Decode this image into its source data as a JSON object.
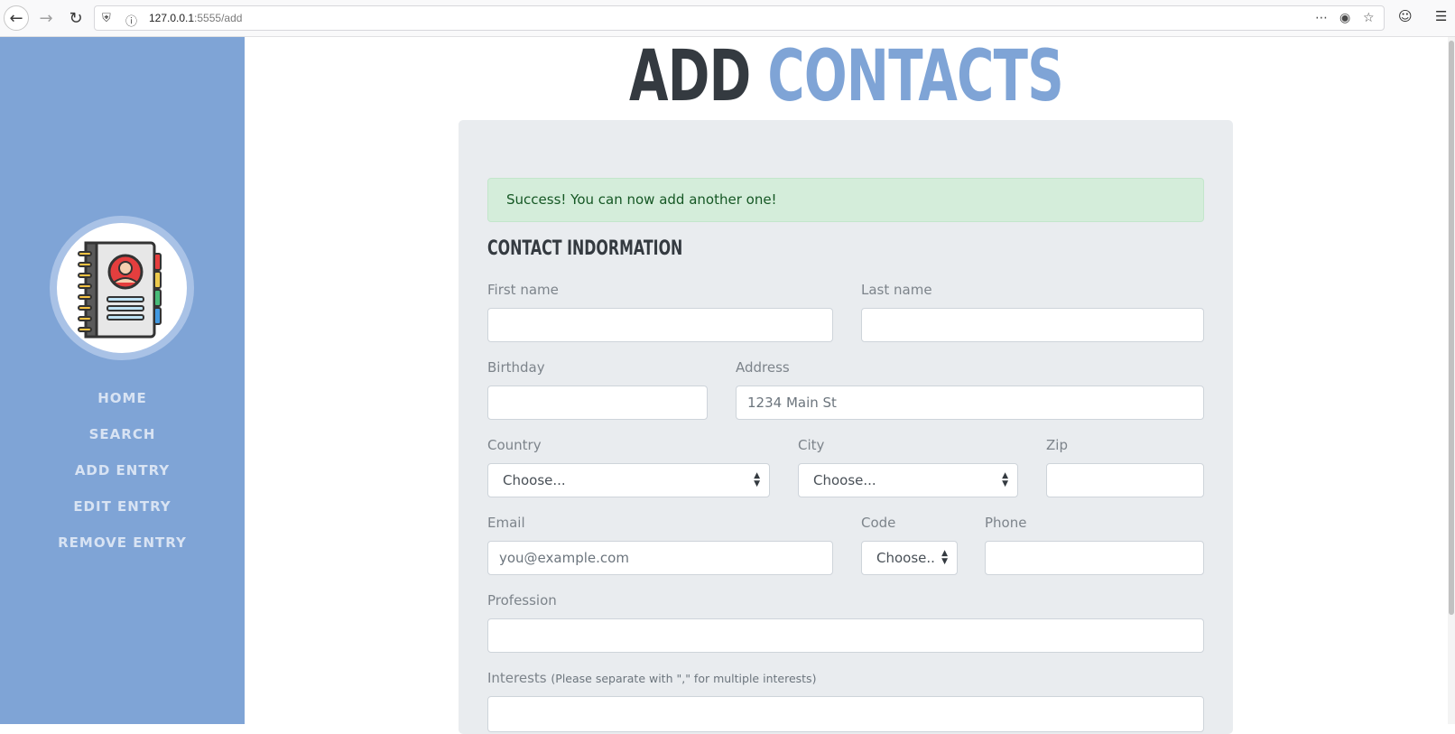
{
  "browser": {
    "url_host": "127.0.0.1",
    "url_path": ":5555/add"
  },
  "sidebar": {
    "items": [
      {
        "label": "HOME"
      },
      {
        "label": "SEARCH"
      },
      {
        "label": "ADD ENTRY"
      },
      {
        "label": "EDIT ENTRY"
      },
      {
        "label": "REMOVE ENTRY"
      }
    ]
  },
  "page": {
    "title_part1": "ADD",
    "title_part2": "CONTACTS"
  },
  "alert": {
    "text": "Success! You can now add another one!"
  },
  "form": {
    "section_title": "CONTACT INDORMATION",
    "first_name_label": "First name",
    "first_name_value": "",
    "last_name_label": "Last name",
    "last_name_value": "",
    "birthday_label": "Birthday",
    "birthday_value": "",
    "address_label": "Address",
    "address_placeholder": "1234 Main St",
    "country_label": "Country",
    "country_selected": "Choose...",
    "city_label": "City",
    "city_selected": "Choose...",
    "zip_label": "Zip",
    "zip_value": "",
    "email_label": "Email",
    "email_placeholder": "you@example.com",
    "code_label": "Code",
    "code_selected": "Choose..",
    "phone_label": "Phone",
    "phone_value": "",
    "profession_label": "Profession",
    "profession_value": "",
    "interests_label": "Interests",
    "interests_hint": "(Please separate with \",\" for multiple interests)",
    "interests_value": ""
  },
  "colors": {
    "sidebar": "#7fa4d6",
    "accent": "#7fa4d6",
    "dark": "#343a40",
    "alert_bg": "#d4edda",
    "card_bg": "#e9ecef"
  }
}
